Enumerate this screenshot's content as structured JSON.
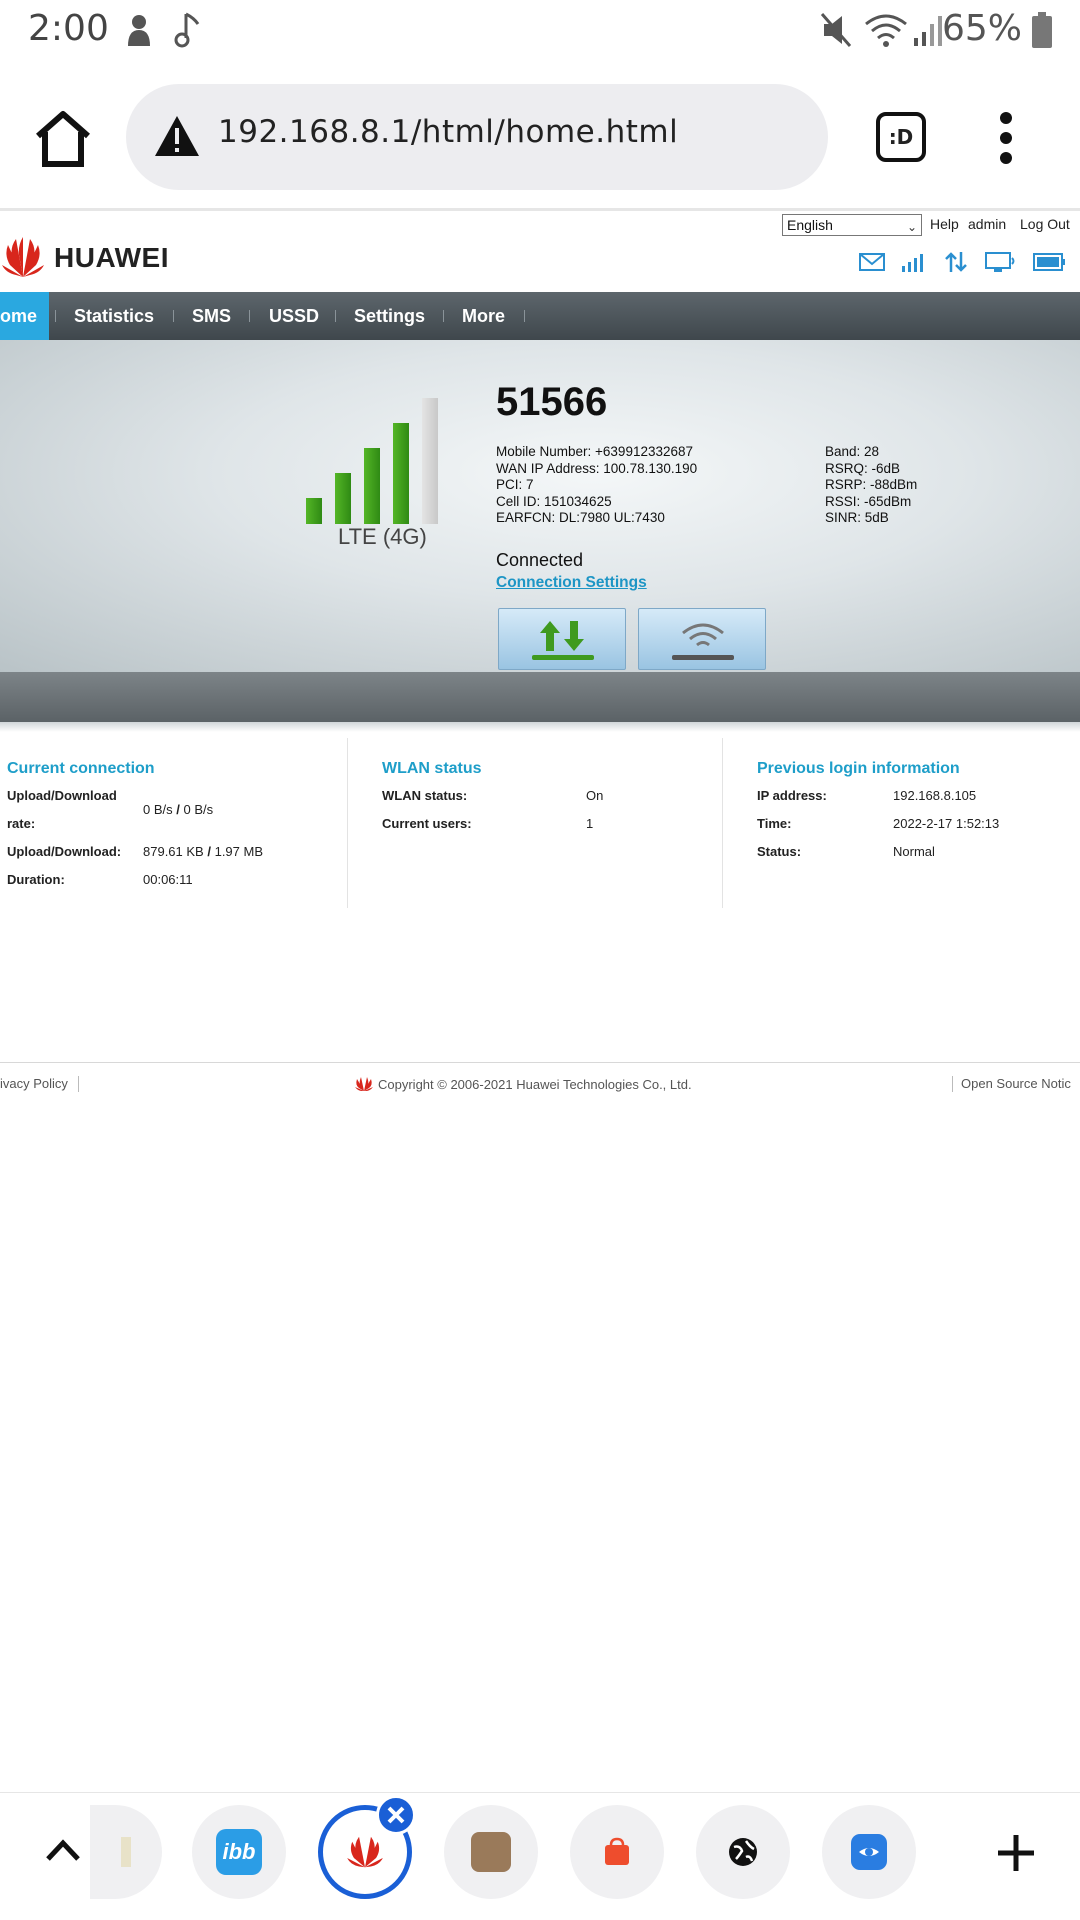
{
  "status_bar": {
    "time": "2:00",
    "battery_percent": "65%",
    "icons": [
      "headset-icon",
      "music-note-icon",
      "mute-icon",
      "wifi-icon",
      "cell-signal-icon",
      "battery-icon"
    ]
  },
  "browser": {
    "url": "192.168.8.1/html/home.html",
    "tab_switcher_label": ":D"
  },
  "header": {
    "language": "English",
    "links": [
      "Help",
      "admin",
      "Log Out"
    ],
    "brand": "HUAWEI"
  },
  "nav": {
    "items": [
      "ome",
      "Statistics",
      "SMS",
      "USSD",
      "Settings",
      "More"
    ]
  },
  "hero": {
    "signal_bars_active": 4,
    "signal_bars_total": 5,
    "network_type": "LTE (4G)",
    "network_name": "51566",
    "left_info": [
      "Mobile Number: +639912332687",
      "WAN IP Address: 100.78.130.190",
      "PCI: 7",
      "Cell ID: 151034625",
      "EARFCN: DL:7980 UL:7430"
    ],
    "right_info": [
      "Band: 28",
      "RSRQ: -6dB",
      "RSRP: -88dBm",
      "RSSI: -65dBm",
      "SINR: 5dB"
    ],
    "connection_status": "Connected",
    "connection_settings": "Connection Settings"
  },
  "panels": {
    "current_connection": {
      "title": "Current connection",
      "rate_label_1": "Upload/Download",
      "rate_label_2": "rate:",
      "rate_up": "0 B/s",
      "rate_sep": "/",
      "rate_down": "0 B/s",
      "total_label": "Upload/Download:",
      "total_up": "879.61 KB",
      "total_sep": "/",
      "total_down": "1.97 MB",
      "duration_label": "Duration:",
      "duration": "00:06:11"
    },
    "wlan_status": {
      "title": "WLAN status",
      "status_label": "WLAN status:",
      "status": "On",
      "users_label": "Current users:",
      "users": "1"
    },
    "previous_login": {
      "title": "Previous login information",
      "ip_label": "IP address:",
      "ip": "192.168.8.105",
      "time_label": "Time:",
      "time": "2022-2-17 1:52:13",
      "status_label": "Status:",
      "status": "Normal"
    }
  },
  "footer": {
    "privacy": "ivacy Policy",
    "copyright": "Copyright © 2006-2021 Huawei Technologies Co., Ltd.",
    "open_source": "Open Source Notic"
  },
  "tab_strip": {
    "ibb_label": "ibb"
  }
}
